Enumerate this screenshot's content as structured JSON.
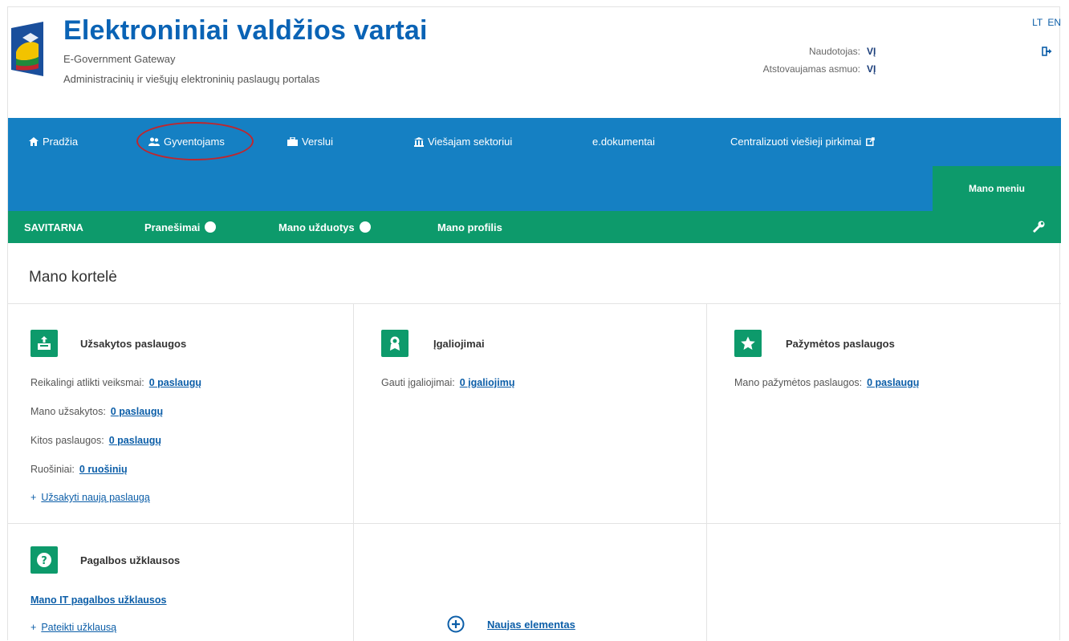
{
  "header": {
    "title": "Elektroniniai valdžios vartai",
    "subtitle_en": "E-Government Gateway",
    "subtitle_portal": "Administracinių ir viešųjų elektroninių paslaugų portalas",
    "lang_lt": "LT",
    "lang_en": "EN",
    "user_label": "Naudotojas:",
    "user_value": "VĮ",
    "represented_label": "Atstovaujamas asmuo:",
    "represented_value": "VĮ"
  },
  "topnav": {
    "items": [
      {
        "label": "Pradžia",
        "icon": "home-icon"
      },
      {
        "label": "Gyventojams",
        "icon": "people-icon"
      },
      {
        "label": "Verslui",
        "icon": "briefcase-icon"
      },
      {
        "label": "Viešajam sektoriui",
        "icon": "institution-icon"
      },
      {
        "label": "e.dokumentai",
        "icon": ""
      },
      {
        "label": "Centralizuoti viešieji pirkimai",
        "icon": "external-link-icon"
      }
    ],
    "mano_meniu": "Mano meniu"
  },
  "subnav": {
    "items": [
      "SAVITARNA",
      "Pranešimai",
      "Mano užduotys",
      "Mano profilis"
    ]
  },
  "card": {
    "title": "Mano kortelė"
  },
  "tiles": {
    "uzsakytos": {
      "title": "Užsakytos paslaugos",
      "rows": [
        {
          "label": "Reikalingi atlikti veiksmai:",
          "link": "0 paslaugų"
        },
        {
          "label": "Mano užsakytos:",
          "link": "0 paslaugų"
        },
        {
          "label": "Kitos paslaugos:",
          "link": "0 paslaugų"
        },
        {
          "label": "Ruošiniai:",
          "link": "0 ruošinių"
        }
      ],
      "action": "Užsakyti naują paslaugą"
    },
    "igaliojimai": {
      "title": "Įgaliojimai",
      "row_label": "Gauti įgaliojimai:",
      "row_link": "0 įgaliojimų"
    },
    "pazymetos": {
      "title": "Pažymėtos paslaugos",
      "row_label": "Mano pažymėtos paslaugos:",
      "row_link": "0 paslaugų"
    },
    "pagalbos": {
      "title": "Pagalbos užklausos",
      "link": "Mano IT pagalbos užklausos",
      "action": "Pateikti užklausą"
    },
    "naujas": {
      "label": "Naujas elementas"
    }
  },
  "colors": {
    "nav_blue": "#1580c3",
    "nav_green": "#0d9a6b",
    "title_blue": "#0a63b5",
    "highlight_red": "#c0262d"
  }
}
